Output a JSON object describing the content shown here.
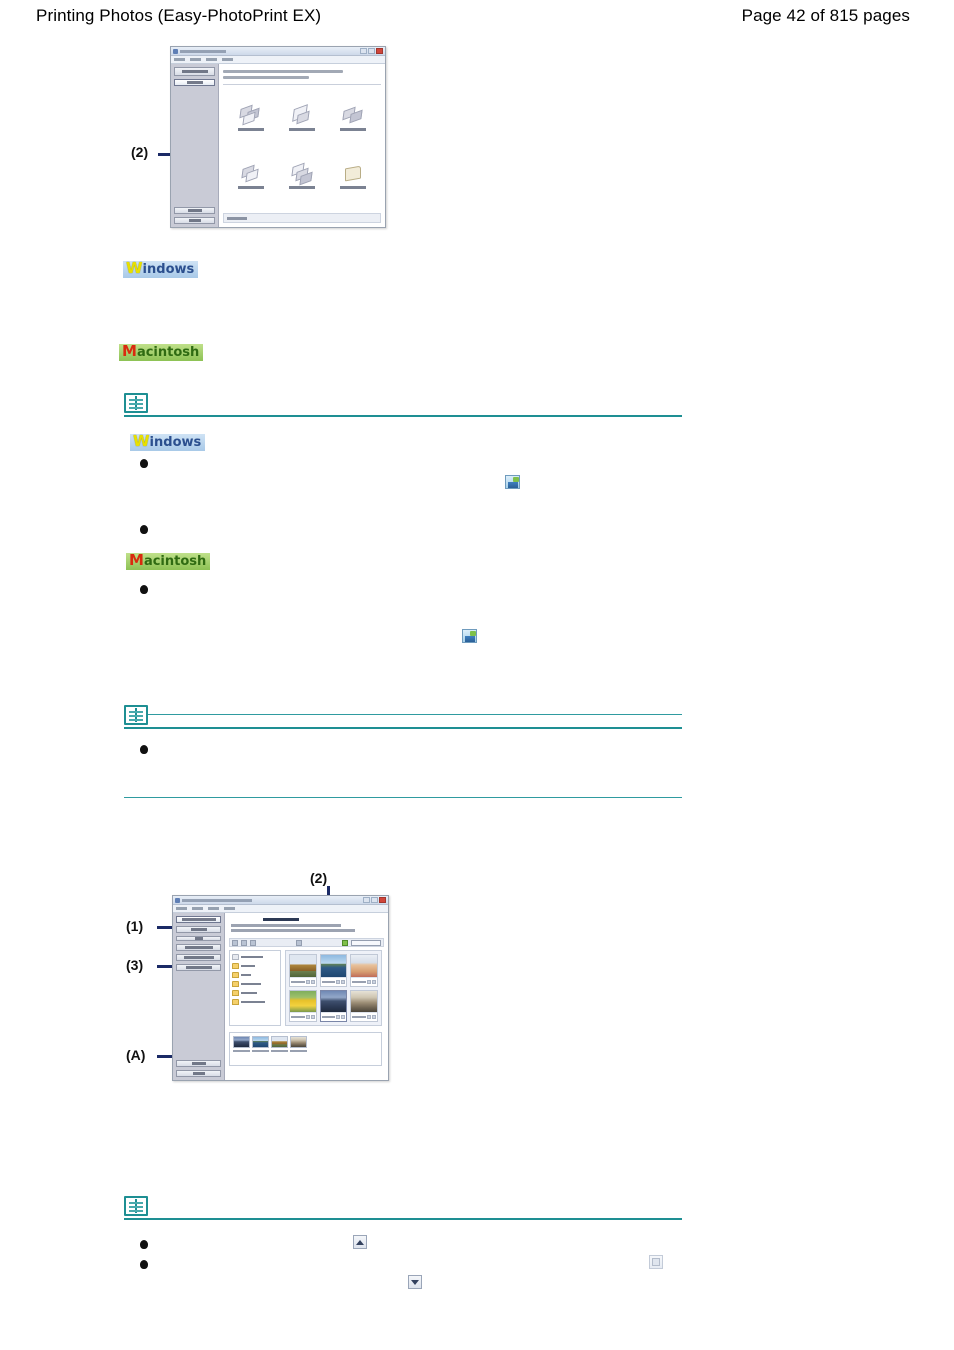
{
  "header": {
    "title": "Printing Photos (Easy-PhotoPrint EX)",
    "page_label": "Page 42 of 815 pages"
  },
  "platform_badges": {
    "windows": {
      "cap": "W",
      "rest": "indows"
    },
    "macintosh": {
      "cap": "M",
      "rest": "acintosh"
    }
  },
  "callouts": {
    "figure1": [
      {
        "label": "(2)"
      }
    ],
    "figure2": [
      {
        "label": "(1)"
      },
      {
        "label": "(2)"
      },
      {
        "label": "(3)"
      },
      {
        "label": "(A)"
      }
    ]
  },
  "figure1": {
    "name": "easy-photoprint-ex-menu-window",
    "sidebar_buttons": [
      "",
      "",
      ""
    ],
    "sidebar_footer_buttons": [
      "",
      ""
    ],
    "menu_tiles": [
      {
        "name": "photo-print",
        "caption": ""
      },
      {
        "name": "album",
        "caption": ""
      },
      {
        "name": "calendar",
        "caption": ""
      },
      {
        "name": "stickers",
        "caption": ""
      },
      {
        "name": "layout-print",
        "caption": ""
      },
      {
        "name": "library",
        "caption": ""
      }
    ],
    "highlighted_tile": "photo-print"
  },
  "figure2": {
    "name": "easy-photoprint-ex-select-images-window",
    "sidebar_steps": [
      "",
      "",
      "",
      "",
      ""
    ],
    "highlighted_step_index": 3,
    "sidebar_footer_buttons": [
      "",
      ""
    ],
    "folder_tree": [
      {
        "label": ""
      },
      {
        "label": ""
      },
      {
        "label": ""
      },
      {
        "label": ""
      },
      {
        "label": ""
      },
      {
        "label": ""
      }
    ],
    "thumbnails": [
      {
        "name": "photo-dog",
        "style": "img-dog",
        "selected": false
      },
      {
        "name": "photo-lake",
        "style": "img-lake",
        "selected": false
      },
      {
        "name": "photo-baby",
        "style": "img-baby",
        "selected": false
      },
      {
        "name": "photo-sunflower",
        "style": "img-sunflower",
        "selected": false
      },
      {
        "name": "photo-group",
        "style": "img-group",
        "selected": true
      },
      {
        "name": "photo-street",
        "style": "img-street",
        "selected": false
      }
    ],
    "selected_tray": [
      {
        "name": "tray-photo-group",
        "style": "img-group"
      },
      {
        "name": "tray-photo-lake",
        "style": "img-lake"
      },
      {
        "name": "tray-photo-dog",
        "style": "img-dog"
      },
      {
        "name": "tray-photo-street",
        "style": "img-street"
      }
    ]
  },
  "notes": {
    "note1": {
      "icon": "note-book-icon",
      "bullets": [
        "",
        ""
      ]
    },
    "note2": {
      "icon": "note-book-icon",
      "bullets": [
        ""
      ]
    },
    "note3": {
      "icon": "note-book-icon",
      "bullets": [
        "",
        ""
      ]
    }
  },
  "inline_icons": {
    "epp_ex_icon": "easy-photoprint-ex-icon",
    "thumbnail_viewer_icon": "thumbnail-viewer-icon",
    "printer_icon": "printer-icon",
    "scroll_up_button": "scroll-up-icon",
    "scroll_down_button": "scroll-down-icon",
    "delete_button": "delete-icon"
  },
  "colors": {
    "note_rule": "#1e8f93",
    "callout_navy": "#1b2a66",
    "windows_badge_bg": "#a8c9e8",
    "macintosh_badge_bg": "#8dc254"
  }
}
